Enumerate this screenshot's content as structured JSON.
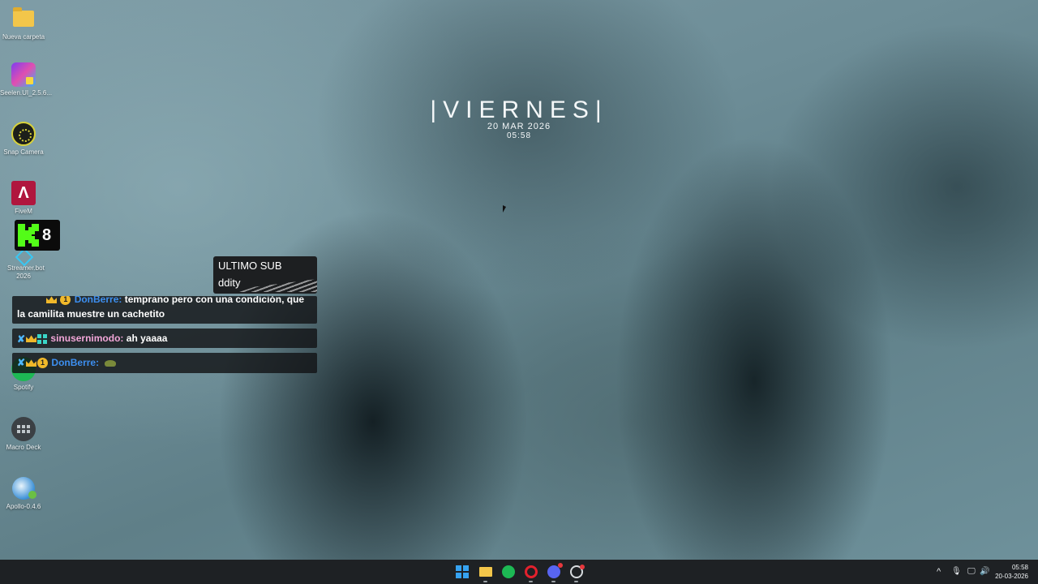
{
  "desktop": {
    "icons": [
      {
        "label": "Nueva carpeta",
        "icon": "folder-icon"
      },
      {
        "label": "Seelen.UI_2.5.6...",
        "icon": "seelen-icon"
      },
      {
        "label": "Snap Camera",
        "icon": "snap-camera-icon"
      },
      {
        "label": "FiveM",
        "icon": "fivem-icon"
      },
      {
        "label": "Streamer.bot 2026",
        "icon": "streamerbot-icon"
      },
      {
        "label": "Spotify",
        "icon": "spotify-icon"
      },
      {
        "label": "Macro Deck",
        "icon": "macro-deck-icon"
      },
      {
        "label": "Apollo-0.4.6",
        "icon": "apollo-icon"
      }
    ],
    "fivem_glyph": "Λ"
  },
  "kick_widget": {
    "count": "8",
    "icon": "kick-logo-icon",
    "color": "#53fc18"
  },
  "clock_widget": {
    "day": "|VIERNES|",
    "date": "20 MAR 2026",
    "time": "05:58"
  },
  "sub_overlay": {
    "title": "ULTIMO SUB",
    "name": "ddity"
  },
  "chat": {
    "messages": [
      {
        "user": "DonBerre:",
        "text_line1": "temprano pero con una condición, que",
        "text_line2": "la camilita muestre un cachetito"
      },
      {
        "user": "sinusernimodo:",
        "text": "ah yaaaa"
      },
      {
        "user": "DonBerre:",
        "text": ""
      }
    ],
    "badge_one": "1",
    "sword_glyph": "✘"
  },
  "taskbar": {
    "apps": [
      "start-icon",
      "file-explorer-icon",
      "spotify-icon",
      "opera-gx-icon",
      "discord-icon",
      "chrome-icon"
    ],
    "tray": {
      "chevron": "^",
      "mic": "🎙",
      "network": "🖵",
      "volume": "🔊"
    },
    "clock_time": "05:58",
    "clock_date": "20-03-2026"
  },
  "colors": {
    "accent": "#36a3f2",
    "taskbar": "#1e2124",
    "chat_bg": "#121416"
  }
}
